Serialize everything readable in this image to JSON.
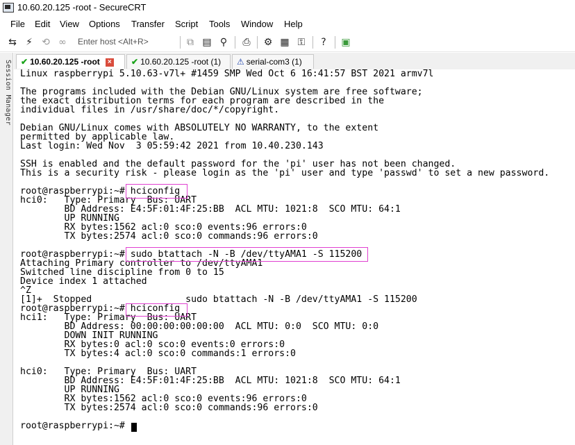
{
  "window": {
    "title": "10.60.20.125 -root - SecureCRT"
  },
  "menu": [
    "File",
    "Edit",
    "View",
    "Options",
    "Transfer",
    "Script",
    "Tools",
    "Window",
    "Help"
  ],
  "toolbar": {
    "quick_connect_placeholder": "Enter host <Alt+R>",
    "icons": [
      "connect-icon",
      "lightning-icon",
      "reconnect-icon",
      "link-icon",
      "copy-icon",
      "paste-icon",
      "find-icon",
      "print-icon",
      "settings-icon",
      "session-options-icon",
      "key-icon",
      "help-icon",
      "sftp-icon"
    ]
  },
  "session_manager": {
    "label": "Session Manager"
  },
  "tabs": [
    {
      "label": "10.60.20.125 -root",
      "status": "connected",
      "active": true
    },
    {
      "label": "10.60.20.125 -root (1)",
      "status": "connected",
      "active": false
    },
    {
      "label": "serial-com3 (1)",
      "status": "warning",
      "active": false
    }
  ],
  "terminal": {
    "lines": [
      "Linux raspberrypi 5.10.63-v7l+ #1459 SMP Wed Oct 6 16:41:57 BST 2021 armv7l",
      "",
      "The programs included with the Debian GNU/Linux system are free software;",
      "the exact distribution terms for each program are described in the",
      "individual files in /usr/share/doc/*/copyright.",
      "",
      "Debian GNU/Linux comes with ABSOLUTELY NO WARRANTY, to the extent",
      "permitted by applicable law.",
      "Last login: Wed Nov  3 05:59:42 2021 from 10.40.230.143",
      "",
      "SSH is enabled and the default password for the 'pi' user has not been changed.",
      "This is a security risk - please login as the 'pi' user and type 'passwd' to set a new password.",
      "",
      "root@raspberrypi:~# hciconfig",
      "hci0:   Type: Primary  Bus: UART",
      "        BD Address: E4:5F:01:4F:25:BB  ACL MTU: 1021:8  SCO MTU: 64:1",
      "        UP RUNNING",
      "        RX bytes:1562 acl:0 sco:0 events:96 errors:0",
      "        TX bytes:2574 acl:0 sco:0 commands:96 errors:0",
      "",
      "root@raspberrypi:~# sudo btattach -N -B /dev/ttyAMA1 -S 115200",
      "Attaching Primary controller to /dev/ttyAMA1",
      "Switched line discipline from 0 to 15",
      "Device index 1 attached",
      "^Z",
      "[1]+  Stopped                 sudo btattach -N -B /dev/ttyAMA1 -S 115200",
      "root@raspberrypi:~# hciconfig",
      "hci1:   Type: Primary  Bus: UART",
      "        BD Address: 00:00:00:00:00:00  ACL MTU: 0:0  SCO MTU: 0:0",
      "        DOWN INIT RUNNING",
      "        RX bytes:0 acl:0 sco:0 events:0 errors:0",
      "        TX bytes:4 acl:0 sco:0 commands:1 errors:0",
      "",
      "hci0:   Type: Primary  Bus: UART",
      "        BD Address: E4:5F:01:4F:25:BB  ACL MTU: 1021:8  SCO MTU: 64:1",
      "        UP RUNNING",
      "        RX bytes:1562 acl:0 sco:0 events:96 errors:0",
      "        TX bytes:2574 acl:0 sco:0 commands:96 errors:0",
      "",
      "root@raspberrypi:~# "
    ]
  },
  "colors": {
    "highlight": "#e040d0",
    "connected": "#1aa31a",
    "tab_close": "#d94c3c"
  }
}
